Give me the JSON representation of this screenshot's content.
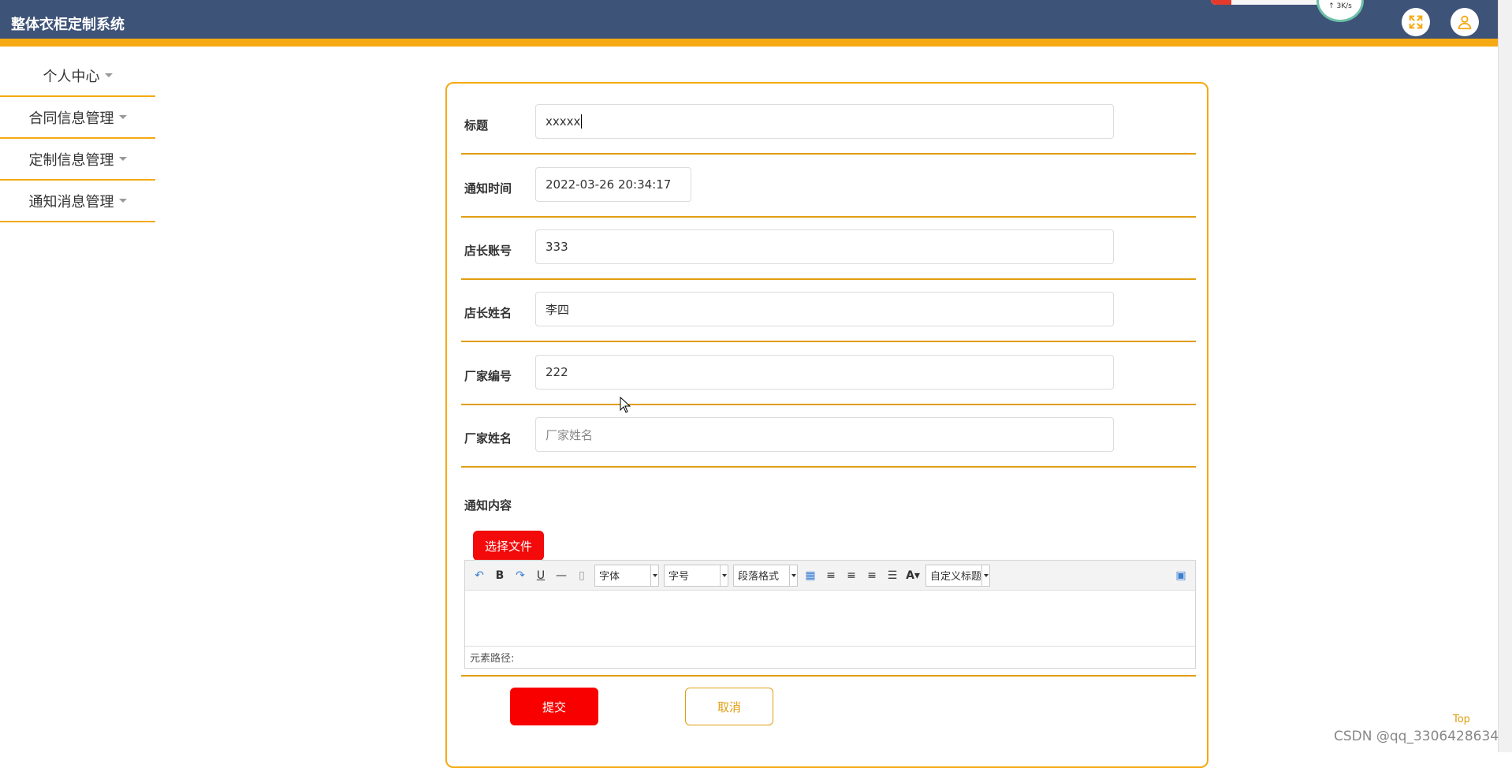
{
  "header": {
    "title": "整体衣柜定制系统",
    "net_speed": "↑ 3K/s",
    "fullscreen_icon": "expand-icon",
    "user_icon": "user-icon"
  },
  "sidebar": {
    "items": [
      {
        "label": "个人中心"
      },
      {
        "label": "合同信息管理"
      },
      {
        "label": "定制信息管理"
      },
      {
        "label": "通知消息管理"
      }
    ]
  },
  "form": {
    "fields": [
      {
        "label": "标题",
        "value": "xxxxx"
      },
      {
        "label": "通知时间",
        "value": "2022-03-26 20:34:17"
      },
      {
        "label": "店长账号",
        "value": "333"
      },
      {
        "label": "店长姓名",
        "value": "李四"
      },
      {
        "label": "厂家编号",
        "value": "222"
      },
      {
        "label": "厂家姓名",
        "placeholder": "厂家姓名"
      }
    ],
    "content_label": "通知内容",
    "file_button": "选择文件",
    "editor": {
      "font_select": "字体",
      "size_select": "字号",
      "paragraph_select": "段落格式",
      "custom_title_select": "自定义标题",
      "status": "元素路径:"
    },
    "submit_label": "提交",
    "cancel_label": "取消"
  },
  "footer": {
    "top_link": "Top",
    "watermark": "CSDN @qq_3306428634"
  },
  "colors": {
    "header_bg": "#3e5378",
    "accent": "#f5a912",
    "primary_button": "#f80000"
  }
}
